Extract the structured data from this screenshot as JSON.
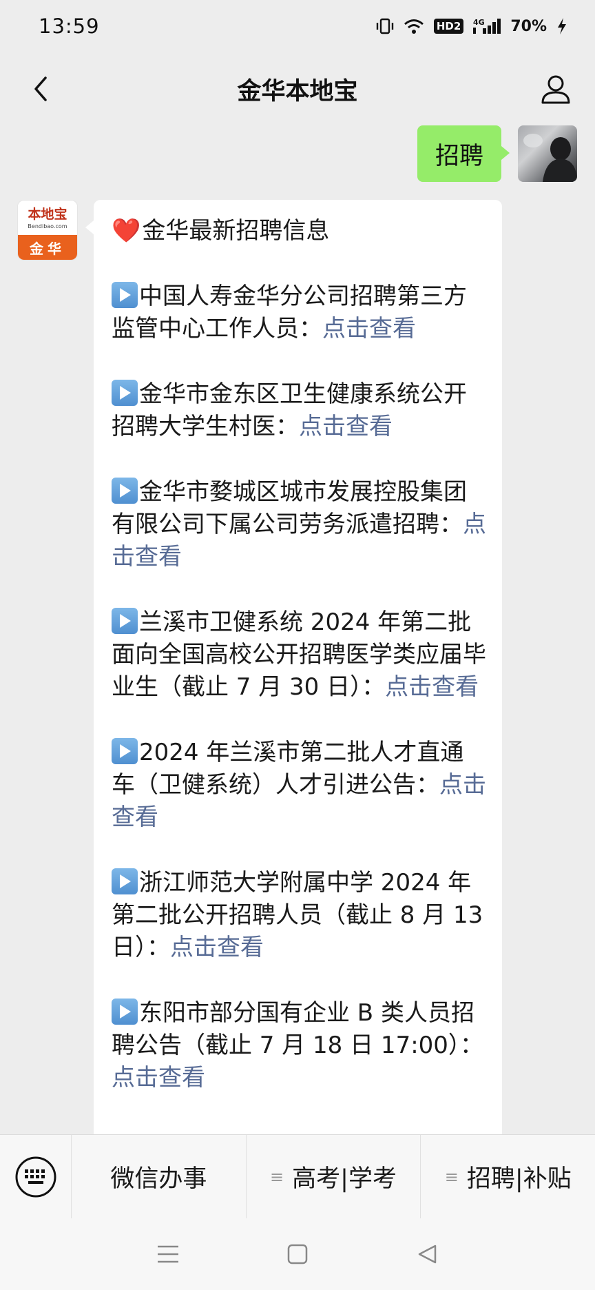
{
  "status_bar": {
    "time": "13:59",
    "network": "4G",
    "hd_label": "HD2",
    "battery": "70%"
  },
  "nav": {
    "title": "金华本地宝"
  },
  "outgoing_message": {
    "text": "招聘"
  },
  "bot": {
    "avatar_logo": "本地宝",
    "avatar_sub": "Bendibao.com",
    "avatar_city": "金华"
  },
  "incoming_message": {
    "heading": "金华最新招聘信息",
    "items": [
      {
        "text": "中国人寿金华分公司招聘第三方监管中心工作人员：",
        "link": "点击查看"
      },
      {
        "text": "金华市金东区卫生健康系统公开招聘大学生村医：",
        "link": "点击查看"
      },
      {
        "text": "金华市婺城区城市发展控股集团有限公司下属公司劳务派遣招聘：",
        "link": "点击查看"
      },
      {
        "text": "兰溪市卫健系统 2024 年第二批面向全国高校公开招聘医学类应届毕业生（截止 7 月 30 日）：",
        "link": "点击查看"
      },
      {
        "text": "2024 年兰溪市第二批人才直通车（卫健系统）人才引进公告：",
        "link": "点击查看"
      },
      {
        "text": "浙江师范大学附属中学 2024 年第二批公开招聘人员（截止 8 月 13 日）：",
        "link": "点击查看"
      },
      {
        "text": "东阳市部分国有企业 B 类人员招聘公告（截止 7 月 18 日 17:00）：",
        "link": "点击查看"
      }
    ]
  },
  "menu": {
    "items": [
      "微信办事",
      "高考|学考",
      "招聘|补贴"
    ]
  },
  "colors": {
    "background": "#ededed",
    "outgoing_bubble": "#95ec69",
    "link": "#576b95",
    "heart": "#e0242c"
  }
}
